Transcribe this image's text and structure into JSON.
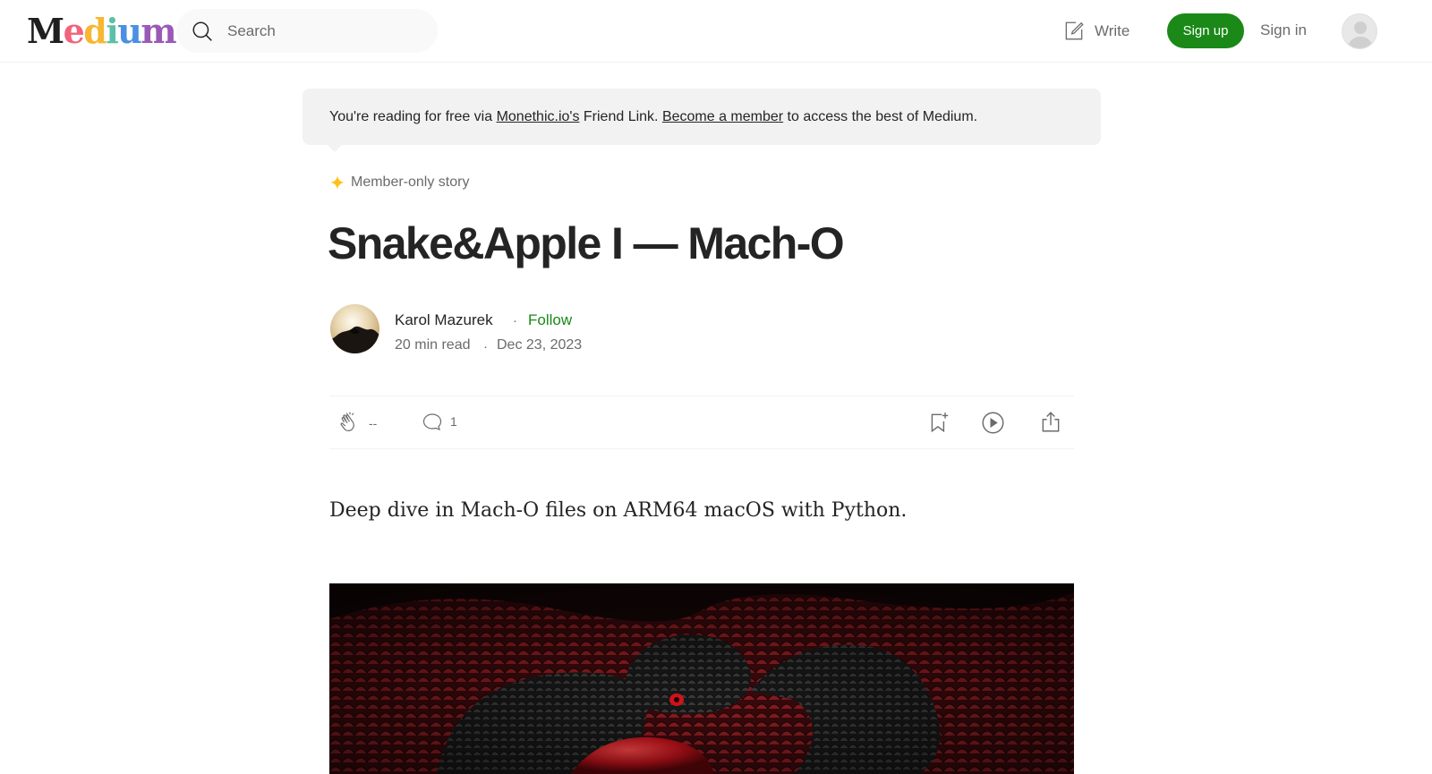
{
  "header": {
    "logo": "Medium",
    "logo_colors": [
      "#1f1f1f",
      "#f2637c",
      "#f7b733",
      "#5bc0a6",
      "#4a90e2",
      "#9b59b6"
    ],
    "search_placeholder": "Search",
    "write_label": "Write",
    "signup_label": "Sign up",
    "signin_label": "Sign in"
  },
  "banner": {
    "prefix": "You're reading for free via ",
    "publisher_link": "Monethic.io's",
    "middle": " Friend Link. ",
    "member_link": "Become a member",
    "suffix": " to access the best of Medium."
  },
  "article": {
    "member_label": "Member-only story",
    "title": "Snake&Apple I — Mach-O",
    "author": "Karol Mazurek",
    "separator": "·",
    "follow_label": "Follow",
    "read_time": "20 min read",
    "date": "Dec 23, 2023",
    "claps": "--",
    "responses": "1",
    "subtitle": "Deep dive in Mach-O files on ARM64 macOS with Python."
  },
  "colors": {
    "accent_green": "#1a8917",
    "text_primary": "#242424",
    "text_secondary": "#6b6b6b",
    "banner_bg": "#f2f2f2",
    "star": "#ffc017"
  }
}
